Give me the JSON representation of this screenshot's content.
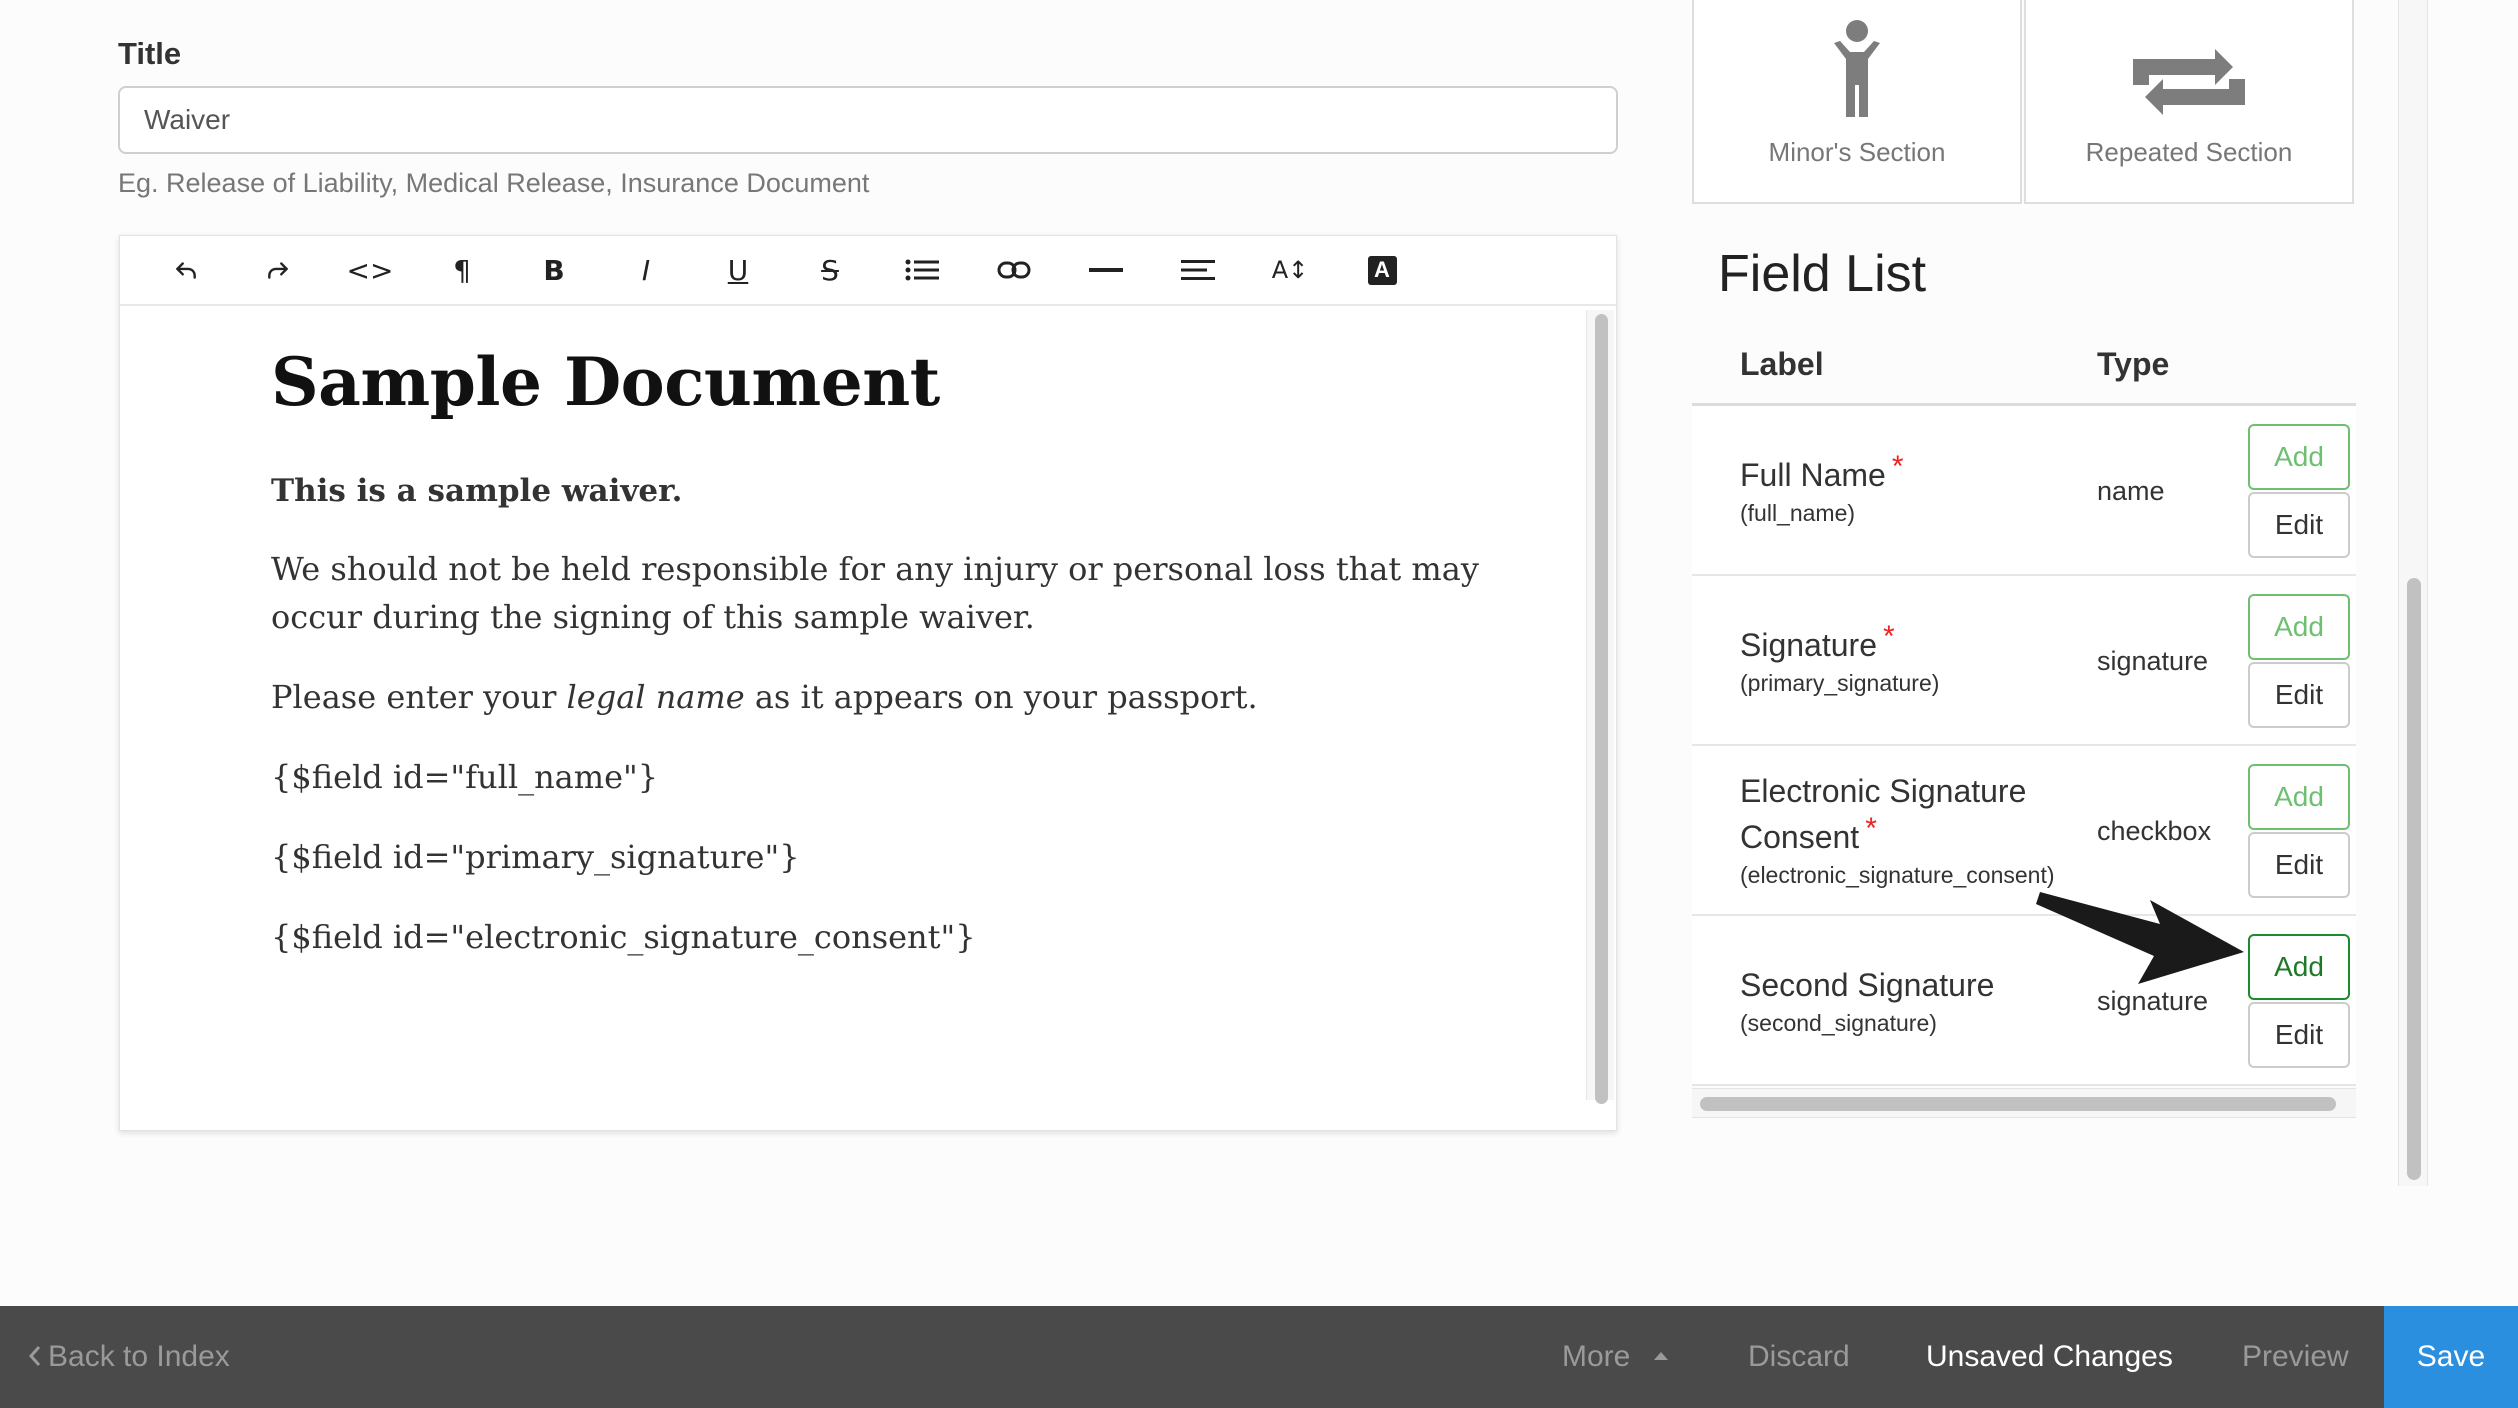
{
  "form": {
    "title_label": "Title",
    "title_value": "Waiver",
    "title_help": "Eg. Release of Liability, Medical Release, Insurance Document"
  },
  "toolbar": {
    "tools": [
      "undo-icon",
      "redo-icon",
      "code-view-icon",
      "paragraph-icon",
      "bold-icon",
      "italic-icon",
      "underline-icon",
      "strikethrough-icon",
      "bulleted-list-icon",
      "link-icon",
      "horizontal-rule-icon",
      "align-icon",
      "font-size-icon",
      "font-color-icon"
    ],
    "bold_glyph": "B",
    "italic_glyph": "I",
    "underline_glyph": "U",
    "strike_glyph": "S",
    "paragraph_glyph": "¶",
    "code_glyph": "<>",
    "fontsize_glyph": "A↕",
    "fontcolor_glyph": "A"
  },
  "document": {
    "heading": "Sample Document",
    "intro": "This is a sample waiver.",
    "body1": "We should not be held responsible for any injury or personal loss that may occur during the signing of this sample waiver.",
    "body2_before": "Please enter your ",
    "body2_em": "legal name",
    "body2_after": " as it appears on your passport.",
    "field1": "{$field id=\"full_name\"}",
    "field2": "{$field id=\"primary_signature\"}",
    "field3": "{$field id=\"electronic_signature_consent\"}"
  },
  "widgets": {
    "minor": "Minor's Section",
    "repeated": "Repeated Section"
  },
  "field_list": {
    "title": "Field List",
    "col_label": "Label",
    "col_type": "Type",
    "required_mark": "*",
    "add_label": "Add",
    "edit_label": "Edit",
    "rows": [
      {
        "label": "Full Name",
        "id": "(full_name)",
        "type": "name",
        "required": true
      },
      {
        "label": "Signature",
        "id": "(primary_signature)",
        "type": "signature",
        "required": true
      },
      {
        "label_line1": "Electronic Signature",
        "label_line2": "Consent",
        "id": "(electronic_signature_consent)",
        "type": "checkbox",
        "required": true
      },
      {
        "label": "Second Signature",
        "id": "(second_signature)",
        "type": "signature",
        "required": false
      }
    ]
  },
  "bottom_bar": {
    "back": "Back to Index",
    "more": "More",
    "discard": "Discard",
    "unsaved": "Unsaved Changes",
    "preview": "Preview",
    "save": "Save"
  },
  "colors": {
    "accent_blue": "#2b8fe0",
    "add_green": "#6fbf73",
    "add_green_active": "#1e7a2a",
    "required_red": "#e22",
    "bottom_bar": "#4a4a4a"
  }
}
